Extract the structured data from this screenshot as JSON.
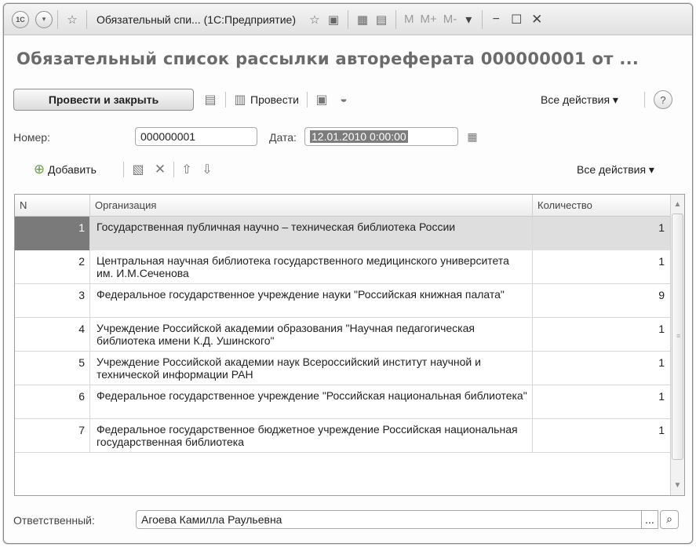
{
  "titlebar": {
    "badge": "1С",
    "title": "Обязательный спи... (1С:Предприятие)",
    "m_buttons": [
      "M",
      "M+",
      "M-"
    ]
  },
  "header": {
    "title": "Обязательный список рассылки автореферата 000000001 от ..."
  },
  "toolbar": {
    "post_close_label": "Провести и закрыть",
    "post_label": "Провести",
    "all_actions_label": "Все действия"
  },
  "fields": {
    "number_label": "Номер:",
    "number_value": "000000001",
    "date_label": "Дата:",
    "date_value": "12.01.2010  0:00:00",
    "responsible_label": "Ответственный:",
    "responsible_value": "Агоева Камилла Раульевна",
    "responsible_dots": "..."
  },
  "table_toolbar": {
    "add_label": "Добавить",
    "all_actions_label": "Все действия"
  },
  "table": {
    "columns": [
      "N",
      "Организация",
      "Количество"
    ],
    "rows": [
      {
        "n": "1",
        "org": "Государственная публичная научно – техническая библиотека России",
        "qty": "1"
      },
      {
        "n": "2",
        "org": "Центральная научная библиотека государственного медицинского университета им. И.М.Сеченова",
        "qty": "1"
      },
      {
        "n": "3",
        "org": "Федеральное государственное учреждение науки \"Российская книжная палата\"",
        "qty": "9"
      },
      {
        "n": "4",
        "org": "Учреждение Российской академии образования \"Научная педагогическая библиотека имени К.Д. Ушинского\"",
        "qty": "1"
      },
      {
        "n": "5",
        "org": "Учреждение Российской академии наук Всероссийский институт научной и технической информации РАН",
        "qty": "1"
      },
      {
        "n": "6",
        "org": "Федеральное государственное учреждение \"Российская национальная библиотека\"",
        "qty": "1"
      },
      {
        "n": "7",
        "org": "Федеральное государственное бюджетное учреждение Российская национальная государственная библиотека",
        "qty": "1"
      }
    ]
  },
  "colors": {
    "selected_row_number": "#7a7a7a",
    "selected_row_bg": "#dedede",
    "date_selection": "#7c7c7c"
  }
}
